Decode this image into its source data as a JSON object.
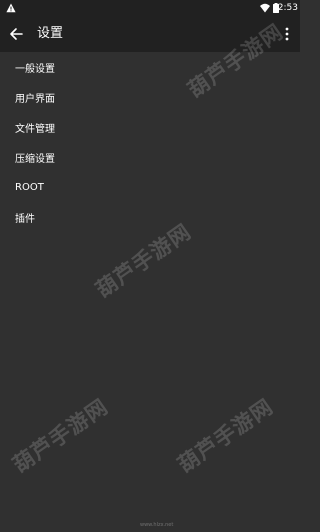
{
  "status_bar": {
    "time": "2:53",
    "icons": [
      "warning-icon",
      "wifi-icon",
      "battery-icon"
    ]
  },
  "app_bar": {
    "title": "设置",
    "back_icon": "arrow-back-icon",
    "menu_icon": "more-vert-icon"
  },
  "settings": {
    "items": [
      {
        "label": "一般设置"
      },
      {
        "label": "用户界面"
      },
      {
        "label": "文件管理"
      },
      {
        "label": "压缩设置"
      },
      {
        "label": "ROOT"
      },
      {
        "label": "插件"
      }
    ]
  },
  "watermark": {
    "text": "葫芦手游网",
    "footer": "www.hlzx.net"
  },
  "colors": {
    "background": "#303030",
    "app_bar": "#212121",
    "text": "#ffffff"
  }
}
